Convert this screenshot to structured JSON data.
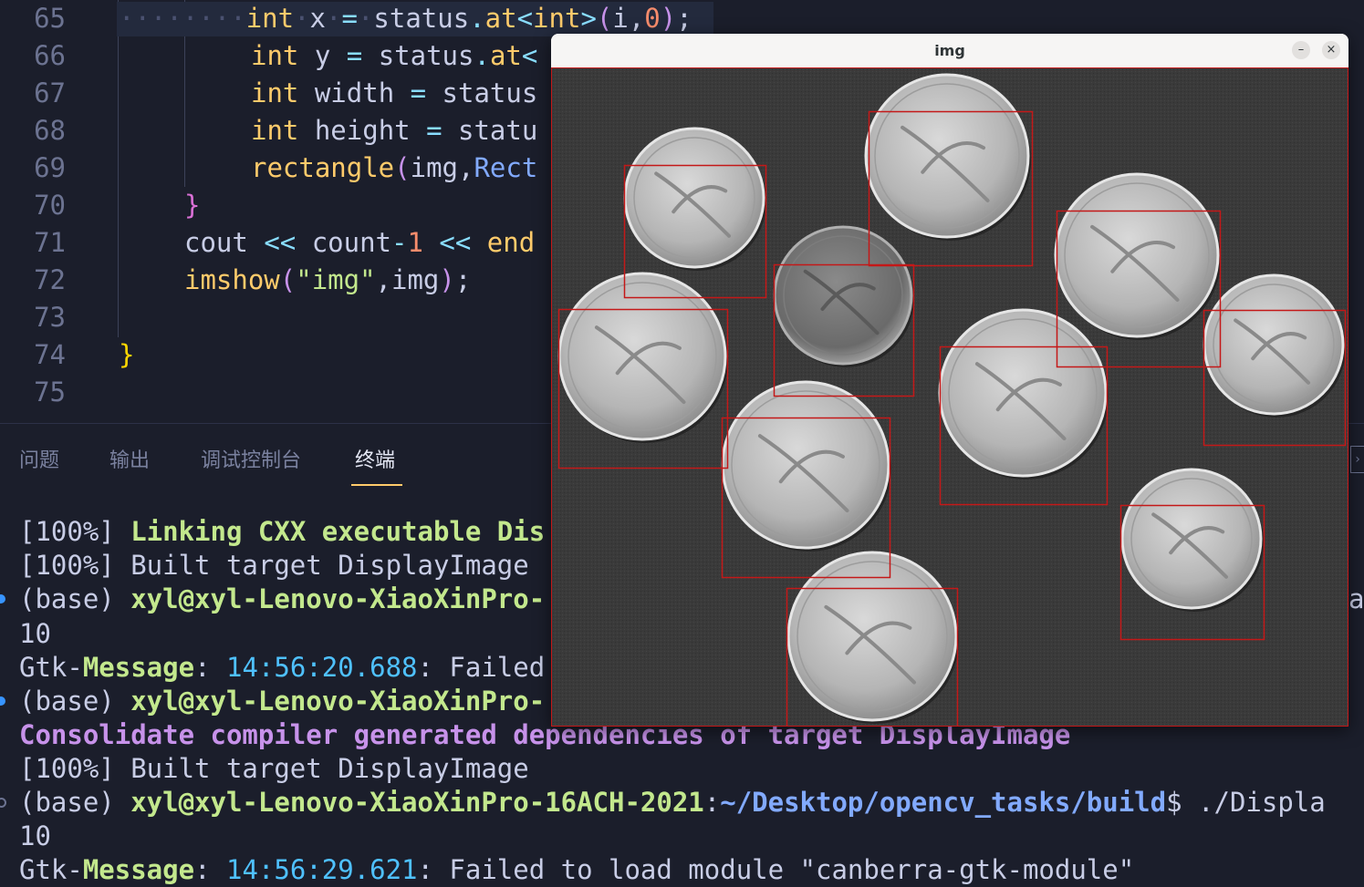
{
  "editor": {
    "lines": [
      {
        "num": "65",
        "tokens": [
          [
            "dots",
            "········"
          ],
          [
            "kw",
            "int"
          ],
          [
            "dots",
            "·"
          ],
          [
            "tx",
            "x"
          ],
          [
            "dots",
            "·"
          ],
          [
            "op",
            "="
          ],
          [
            "dots",
            "·"
          ],
          [
            "tx",
            "status"
          ],
          [
            "op",
            "."
          ],
          [
            "fn",
            "at"
          ],
          [
            "op",
            "<"
          ],
          [
            "kw",
            "int"
          ],
          [
            "op",
            ">"
          ],
          [
            "pn",
            "("
          ],
          [
            "tx",
            "i,"
          ],
          [
            "num",
            "0"
          ],
          [
            "pn",
            ")"
          ],
          [
            "tx",
            ";"
          ]
        ]
      },
      {
        "num": "66",
        "tokens": [
          [
            "kw",
            "int"
          ],
          [
            "tx",
            " y "
          ],
          [
            "op",
            "="
          ],
          [
            "tx",
            " status"
          ],
          [
            "op",
            "."
          ],
          [
            "fn",
            "at"
          ],
          [
            "op",
            "<"
          ]
        ]
      },
      {
        "num": "67",
        "tokens": [
          [
            "kw",
            "int"
          ],
          [
            "tx",
            " width "
          ],
          [
            "op",
            "="
          ],
          [
            "tx",
            " status"
          ]
        ]
      },
      {
        "num": "68",
        "tokens": [
          [
            "kw",
            "int"
          ],
          [
            "tx",
            " height "
          ],
          [
            "op",
            "="
          ],
          [
            "tx",
            " statu"
          ]
        ]
      },
      {
        "num": "69",
        "tokens": [
          [
            "fn",
            "rectangle"
          ],
          [
            "pn",
            "("
          ],
          [
            "tx",
            "img,"
          ],
          [
            "ty",
            "Rect"
          ]
        ]
      },
      {
        "num": "70",
        "tokens": [
          [
            "brace2",
            "}"
          ]
        ]
      },
      {
        "num": "71",
        "tokens": [
          [
            "tx",
            "cout "
          ],
          [
            "op",
            "<<"
          ],
          [
            "tx",
            " count"
          ],
          [
            "op",
            "-"
          ],
          [
            "num",
            "1"
          ],
          [
            "tx",
            " "
          ],
          [
            "op",
            "<<"
          ],
          [
            "tx",
            " "
          ],
          [
            "fn",
            "end"
          ]
        ]
      },
      {
        "num": "72",
        "tokens": [
          [
            "fn",
            "imshow"
          ],
          [
            "pn",
            "("
          ],
          [
            "str",
            "\"img\""
          ],
          [
            "tx",
            ",img"
          ],
          [
            "pn",
            ")"
          ],
          [
            "tx",
            ";"
          ]
        ]
      },
      {
        "num": "73",
        "tokens": []
      },
      {
        "num": "74",
        "tokens": [
          [
            "brace",
            "}"
          ]
        ]
      },
      {
        "num": "75",
        "tokens": []
      }
    ]
  },
  "panel": {
    "tabs": [
      {
        "label": "问题",
        "active": false
      },
      {
        "label": "输出",
        "active": false
      },
      {
        "label": "调试控制台",
        "active": false
      },
      {
        "label": "终端",
        "active": true
      }
    ],
    "terminal": [
      {
        "dot": "",
        "segs": [
          [
            "tx",
            "[100%] "
          ],
          [
            "t-green",
            "Linking CXX executable Dis"
          ]
        ]
      },
      {
        "dot": "",
        "segs": [
          [
            "tx",
            "[100%] Built target DisplayImage"
          ]
        ]
      },
      {
        "dot": "filled",
        "segs": [
          [
            "tx",
            "(base) "
          ],
          [
            "t-green",
            "xyl@xyl-Lenovo-XiaoXinPro-"
          ]
        ],
        "trail": "a"
      },
      {
        "dot": "",
        "segs": [
          [
            "tx",
            "10"
          ]
        ]
      },
      {
        "dot": "",
        "segs": [
          [
            "tx",
            "Gtk-"
          ],
          [
            "t-msg",
            "Message"
          ],
          [
            "tx",
            ": "
          ],
          [
            "t-cyan",
            "14:56:20.688"
          ],
          [
            "tx",
            ": Failed"
          ]
        ]
      },
      {
        "dot": "filled",
        "segs": [
          [
            "tx",
            "(base) "
          ],
          [
            "t-green",
            "xyl@xyl-Lenovo-XiaoXinPro-"
          ]
        ]
      },
      {
        "dot": "",
        "segs": [
          [
            "t-purple",
            "Consolidate compiler generated dependencies of target DisplayImage"
          ]
        ]
      },
      {
        "dot": "",
        "segs": [
          [
            "tx",
            "[100%] Built target DisplayImage"
          ]
        ]
      },
      {
        "dot": "hollow",
        "segs": [
          [
            "tx",
            "(base) "
          ],
          [
            "t-green",
            "xyl@xyl-Lenovo-XiaoXinPro-16ACH-2021"
          ],
          [
            "tx",
            ":"
          ],
          [
            "t-blue",
            "~/Desktop/opencv_tasks/build"
          ],
          [
            "tx",
            "$ ./Displa"
          ]
        ]
      },
      {
        "dot": "",
        "segs": [
          [
            "tx",
            "10"
          ]
        ]
      },
      {
        "dot": "",
        "segs": [
          [
            "tx",
            "Gtk-"
          ],
          [
            "t-msg",
            "Message"
          ],
          [
            "tx",
            ": "
          ],
          [
            "t-cyan",
            "14:56:29.621"
          ],
          [
            "tx",
            ": Failed to load module \"canberra-gtk-module\""
          ]
        ]
      }
    ]
  },
  "img_window": {
    "title": "img",
    "minimize_icon": "–",
    "close_icon": "×",
    "coin_count": 10,
    "box_color": "#c41818"
  }
}
